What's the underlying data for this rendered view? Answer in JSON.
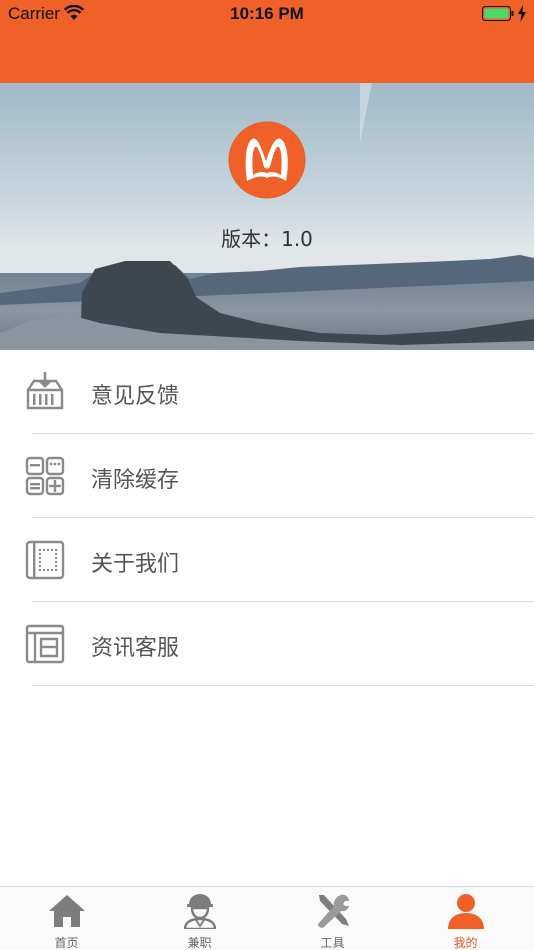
{
  "status_bar": {
    "carrier": "Carrier",
    "time": "10:16 PM",
    "battery_icon": "battery-full-icon",
    "wifi_icon": "wifi-icon"
  },
  "colors": {
    "accent": "#f0612a",
    "tab_active": "#e0552a",
    "tab_inactive": "#8c8c8c"
  },
  "header": {
    "logo_icon": "rabbit-m-logo",
    "version_text": "版本：1.0"
  },
  "menu": {
    "items": [
      {
        "label": "意见反馈",
        "icon": "inbox-download-icon"
      },
      {
        "label": "清除缓存",
        "icon": "calculator-grid-icon"
      },
      {
        "label": "关于我们",
        "icon": "dotted-frame-icon"
      },
      {
        "label": "资讯客服",
        "icon": "layout-panel-icon"
      }
    ]
  },
  "tabbar": {
    "tabs": [
      {
        "label": "首页",
        "icon": "home-icon",
        "active": false
      },
      {
        "label": "兼职",
        "icon": "worker-icon",
        "active": false
      },
      {
        "label": "工具",
        "icon": "tools-icon",
        "active": false
      },
      {
        "label": "我的",
        "icon": "person-icon",
        "active": true
      }
    ]
  }
}
